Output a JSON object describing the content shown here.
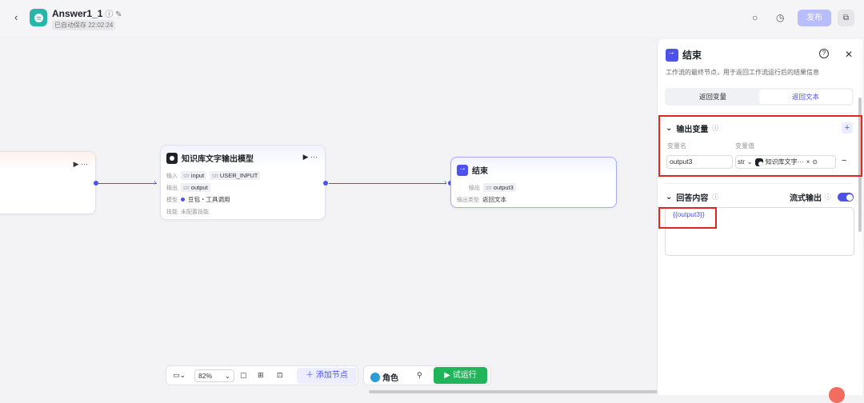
{
  "header": {
    "title": "Answer1_1",
    "saved": "已自动保存 22:02:24",
    "publish_label": "发布"
  },
  "canvas": {
    "llm_node": {
      "title": "知识库文字输出模型",
      "in_label": "输入",
      "in_params": [
        {
          "type": "str",
          "name": "input"
        },
        {
          "type": "str",
          "name": "USER_INPUT"
        }
      ],
      "out_label": "输出",
      "out_param": {
        "type": "str",
        "name": "output"
      },
      "model_label": "模型",
      "model_value": "豆包・工具调用",
      "skill_label": "技能",
      "skill_value": "未配置技能"
    },
    "end_node": {
      "title": "结束",
      "out_label": "输出",
      "out_param": {
        "type": "str",
        "name": "output3"
      },
      "type_label": "输出类型",
      "type_value": "返回文本"
    }
  },
  "toolbar": {
    "zoom": "82%",
    "add_node": "添加节点",
    "role": "角色",
    "run": "试运行"
  },
  "panel": {
    "title": "结束",
    "desc": "工作流的最终节点，用于返回工作流运行后的结果信息",
    "tabs": [
      "返回变量",
      "返回文本"
    ],
    "output_section": "输出变量",
    "col_name": "变量名",
    "col_value": "变量值",
    "var_name": "output3",
    "var_type": "str",
    "var_ref": "知识库文字···",
    "answer_section": "回答内容",
    "stream_label": "流式输出",
    "answer_text": "{{output3}}"
  }
}
